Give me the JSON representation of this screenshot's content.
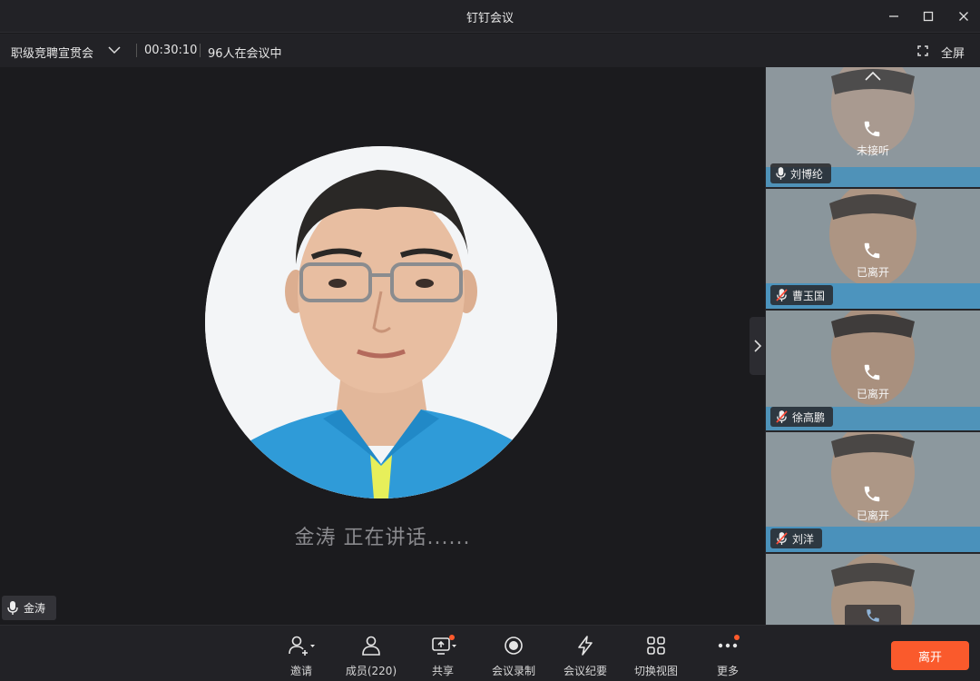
{
  "window": {
    "title": "钉钉会议"
  },
  "infobar": {
    "meeting_name": "职级竞聘宣贯会",
    "elapsed": "00:30:10",
    "participants_in_meeting": "96人在会议中",
    "fullscreen_label": "全屏"
  },
  "stage": {
    "speaking_text": "金涛 正在讲话......",
    "speaker_name": "金涛"
  },
  "participants": [
    {
      "name": "刘博纶",
      "status": "未接听",
      "mic": "on"
    },
    {
      "name": "曹玉国",
      "status": "已离开",
      "mic": "muted"
    },
    {
      "name": "徐高鹏",
      "status": "已离开",
      "mic": "muted"
    },
    {
      "name": "刘洋",
      "status": "已离开",
      "mic": "muted"
    },
    {
      "name": "",
      "status": "",
      "mic": "muted"
    }
  ],
  "toolbar": {
    "invite": "邀请",
    "members": "成员(220)",
    "share": "共享",
    "record": "会议录制",
    "minutes": "会议纪要",
    "switch_view": "切换视图",
    "more": "更多",
    "leave": "离开"
  },
  "colors": {
    "accent": "#fa5a2c",
    "background": "#1a1a1d",
    "panel": "#222226"
  }
}
